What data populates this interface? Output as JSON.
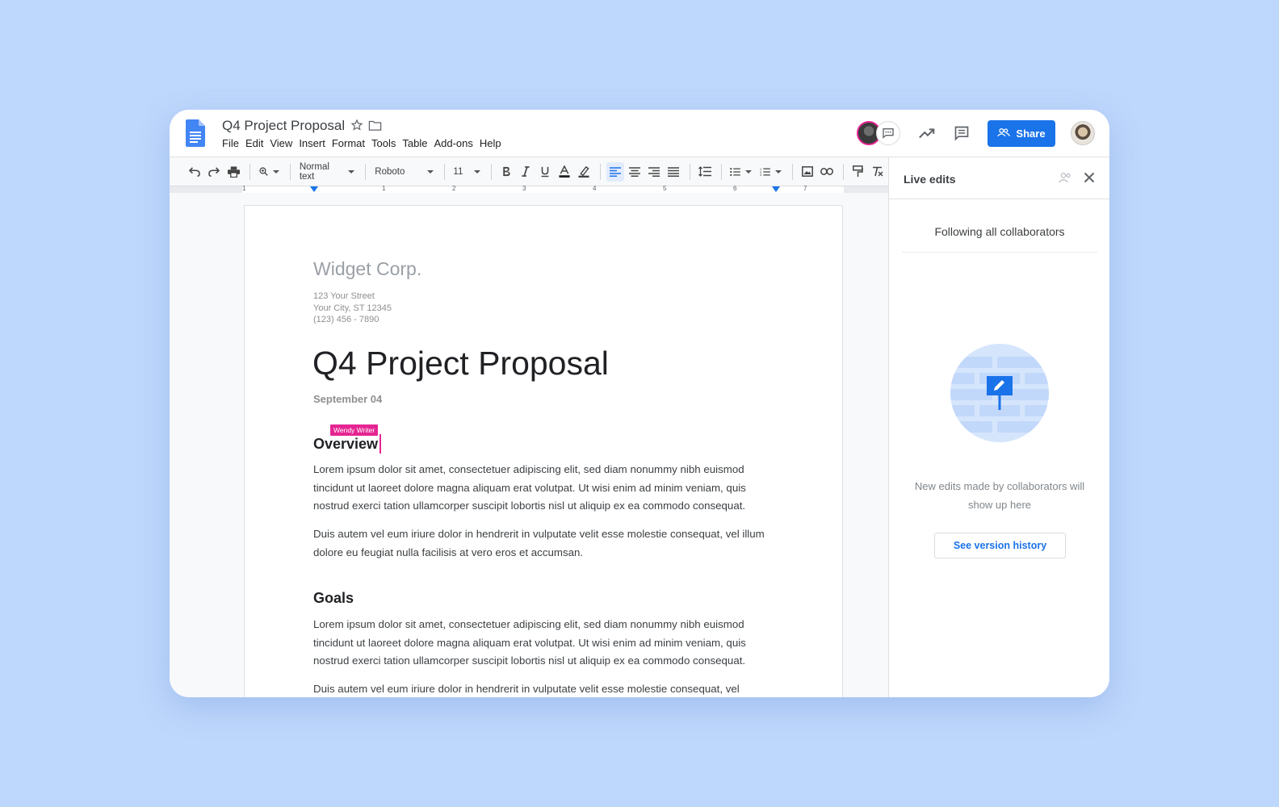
{
  "doc": {
    "title": "Q4 Project Proposal",
    "menu": [
      "File",
      "Edit",
      "View",
      "Insert",
      "Format",
      "Tools",
      "Table",
      "Add-ons",
      "Help"
    ]
  },
  "header": {
    "share_label": "Share"
  },
  "toolbar": {
    "style": "Normal text",
    "font": "Roboto",
    "size": "11"
  },
  "ruler": {
    "labels": [
      "1",
      "1",
      "2",
      "3",
      "4",
      "5",
      "6",
      "7"
    ]
  },
  "page": {
    "company": "Widget Corp.",
    "address": [
      "123 Your Street",
      "Your City, ST 12345",
      "(123) 456 - 7890"
    ],
    "heading": "Q4 Project Proposal",
    "date": "September 04",
    "collaborator_tag": "Wendy Writer",
    "sections": [
      {
        "heading": "Overview",
        "paragraphs": [
          "Lorem ipsum dolor sit amet, consectetuer adipiscing elit, sed diam nonummy nibh euismod tincidunt ut laoreet dolore magna aliquam erat volutpat. Ut wisi enim ad minim veniam, quis nostrud exerci tation ullamcorper suscipit lobortis nisl ut aliquip ex ea commodo consequat.",
          "Duis autem vel eum iriure dolor in hendrerit in vulputate velit esse molestie consequat, vel illum dolore eu feugiat nulla facilisis at vero eros et accumsan."
        ]
      },
      {
        "heading": "Goals",
        "paragraphs": [
          "Lorem ipsum dolor sit amet, consectetuer adipiscing elit, sed diam nonummy nibh euismod tincidunt ut laoreet dolore magna aliquam erat volutpat. Ut wisi enim ad minim veniam, quis nostrud exerci tation ullamcorper suscipit lobortis nisl ut aliquip ex ea commodo consequat.",
          "Duis autem vel eum iriure dolor in hendrerit in vulputate velit esse molestie consequat, vel"
        ]
      }
    ]
  },
  "panel": {
    "title": "Live edits",
    "following": "Following all collaborators",
    "empty_message": "New edits made by collaborators will show up here",
    "history_button": "See version history"
  },
  "colors": {
    "accent": "#1a73e8",
    "collaborator": "#e52592",
    "background": "#bed7fc"
  }
}
